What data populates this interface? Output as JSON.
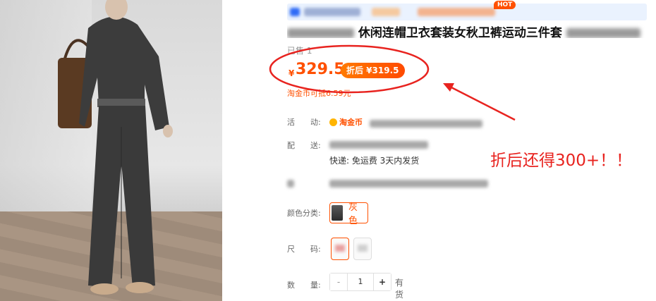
{
  "product_image": {
    "alt": "product-photo"
  },
  "promo_bar": {
    "hot_badge": "HOT"
  },
  "title": {
    "visible_text": "休闲连帽卫衣套装女秋卫裤运动三件套"
  },
  "sales": {
    "sold_label": "已售 1"
  },
  "price": {
    "currency": "¥",
    "amount": "329.5",
    "discount_badge": "折后 ¥319.5",
    "coin_deduct": "淘金币可抵6.59元"
  },
  "activity": {
    "label_1": "活",
    "label_2": "动:",
    "coin_badge": "淘金币"
  },
  "delivery": {
    "label_1": "配",
    "label_2": "送:",
    "express": "快递: 免运费  3天内发货"
  },
  "color": {
    "label": "颜色分类:",
    "options": [
      "灰色"
    ]
  },
  "size": {
    "label_1": "尺",
    "label_2": "码:"
  },
  "quantity": {
    "label_1": "数",
    "label_2": "量:",
    "minus": "-",
    "value": "1",
    "plus": "+",
    "stock": "有货"
  },
  "annotation": {
    "text": "折后还得300+！！",
    "color": "#e8231f"
  },
  "colors": {
    "accent": "#ff5000",
    "promo_bg": "#eaf2fe"
  }
}
